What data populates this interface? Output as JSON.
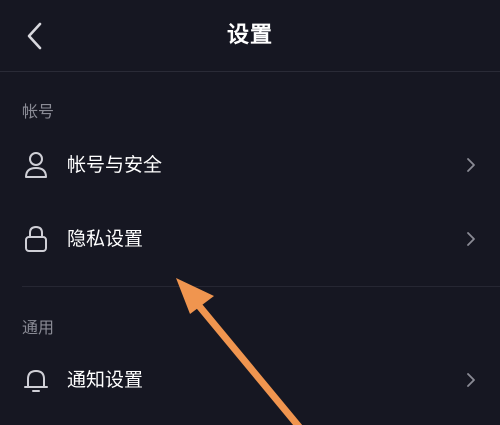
{
  "header": {
    "title": "设置",
    "back_icon": "chevron-left-icon"
  },
  "sections": [
    {
      "label": "帐号",
      "items": [
        {
          "label": "帐号与安全",
          "icon": "user-icon"
        },
        {
          "label": "隐私设置",
          "icon": "lock-icon"
        }
      ]
    },
    {
      "label": "通用",
      "items": [
        {
          "label": "通知设置",
          "icon": "bell-icon"
        }
      ]
    }
  ],
  "colors": {
    "background": "#161722",
    "text": "#ffffff",
    "muted": "#8a8b95",
    "chevron": "#8a8b95",
    "annotation_arrow": "#f0954f"
  }
}
